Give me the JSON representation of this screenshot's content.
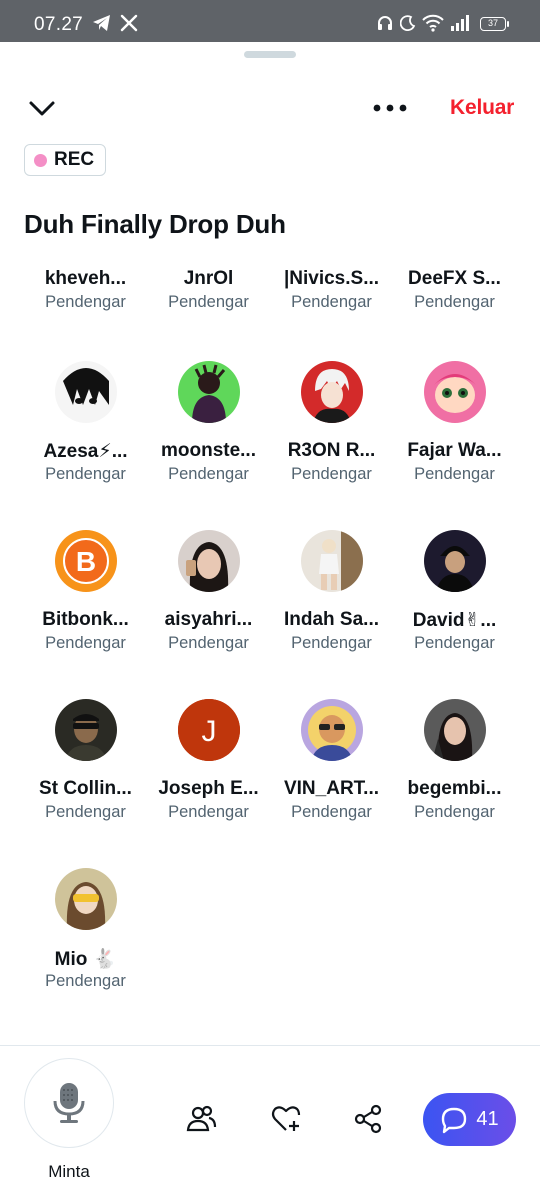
{
  "status_bar": {
    "time": "07.27",
    "battery": "37"
  },
  "header": {
    "leave_label": "Keluar",
    "rec_label": "REC"
  },
  "space": {
    "title": "Duh Finally Drop Duh"
  },
  "listeners": [
    {
      "name": "kheveh...",
      "role": "Pendengar",
      "avatar": "none"
    },
    {
      "name": "JnrOl",
      "role": "Pendengar",
      "avatar": "none"
    },
    {
      "name": "|Nivics.S...",
      "role": "Pendengar",
      "avatar": "none"
    },
    {
      "name": "DeeFX S...",
      "role": "Pendengar",
      "avatar": "none"
    },
    {
      "name": "Azesa⚡...",
      "role": "Pendengar",
      "avatar": "anime-bw"
    },
    {
      "name": "moonste...",
      "role": "Pendengar",
      "avatar": "green-figure"
    },
    {
      "name": "R3ON R...",
      "role": "Pendengar",
      "avatar": "red-anime"
    },
    {
      "name": "Fajar Wa...",
      "role": "Pendengar",
      "avatar": "cartoon-girl"
    },
    {
      "name": "Bitbonk...",
      "role": "Pendengar",
      "avatar": "bitcoin"
    },
    {
      "name": "aisyahri...",
      "role": "Pendengar",
      "avatar": "photo-woman"
    },
    {
      "name": "Indah Sa...",
      "role": "Pendengar",
      "avatar": "photo-room"
    },
    {
      "name": "David✌...",
      "role": "Pendengar",
      "avatar": "photo-cap"
    },
    {
      "name": "St Collin...",
      "role": "Pendengar",
      "avatar": "photo-man-dark"
    },
    {
      "name": "Joseph E...",
      "role": "Pendengar",
      "avatar": "letter",
      "initial": "J"
    },
    {
      "name": "VIN_ART...",
      "role": "Pendengar",
      "avatar": "art-man"
    },
    {
      "name": "begembi...",
      "role": "Pendengar",
      "avatar": "photo-woman-dark"
    },
    {
      "name": "Mio 🐇",
      "role": "Pendengar",
      "avatar": "photo-yellow"
    }
  ],
  "bottom_bar": {
    "mic_label": "Minta",
    "chat_count": "41"
  },
  "colors": {
    "accent_red": "#f4212e",
    "rec_dot": "#f48fc6",
    "chat_gradient_start": "#3b54f2",
    "chat_gradient_end": "#6b4ee8",
    "secondary_text": "#536471"
  }
}
